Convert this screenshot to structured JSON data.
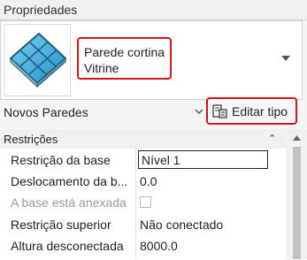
{
  "palette": {
    "title": "Propriedades"
  },
  "type_selector": {
    "family": "Parede cortina",
    "type": "Vitrine",
    "thumbnail_icon": "curtain-wall-panel-icon",
    "dropdown_icon": "dropdown-arrow-icon"
  },
  "instance_filter": {
    "label": "Novos Paredes",
    "chevron_icon": "chevron-down-icon"
  },
  "edit_type": {
    "label": "Editar tipo",
    "icon": "edit-type-icon"
  },
  "groups": [
    {
      "label": "Restrições",
      "collapse_icon": "collapse-chevron-icon",
      "rows": [
        {
          "name": "Restrição da base",
          "value": "Nível 1"
        },
        {
          "name": "Deslocamento da b...",
          "value": "0.0"
        },
        {
          "name": "A base está anexada",
          "value": "",
          "checked": false
        },
        {
          "name": "Restrição superior",
          "value": "Não conectado"
        },
        {
          "name": "Altura desconectada",
          "value": "8000.0"
        }
      ]
    }
  ],
  "colors": {
    "highlight": "#d0161b",
    "panel_glass": "#3aa6d8"
  }
}
